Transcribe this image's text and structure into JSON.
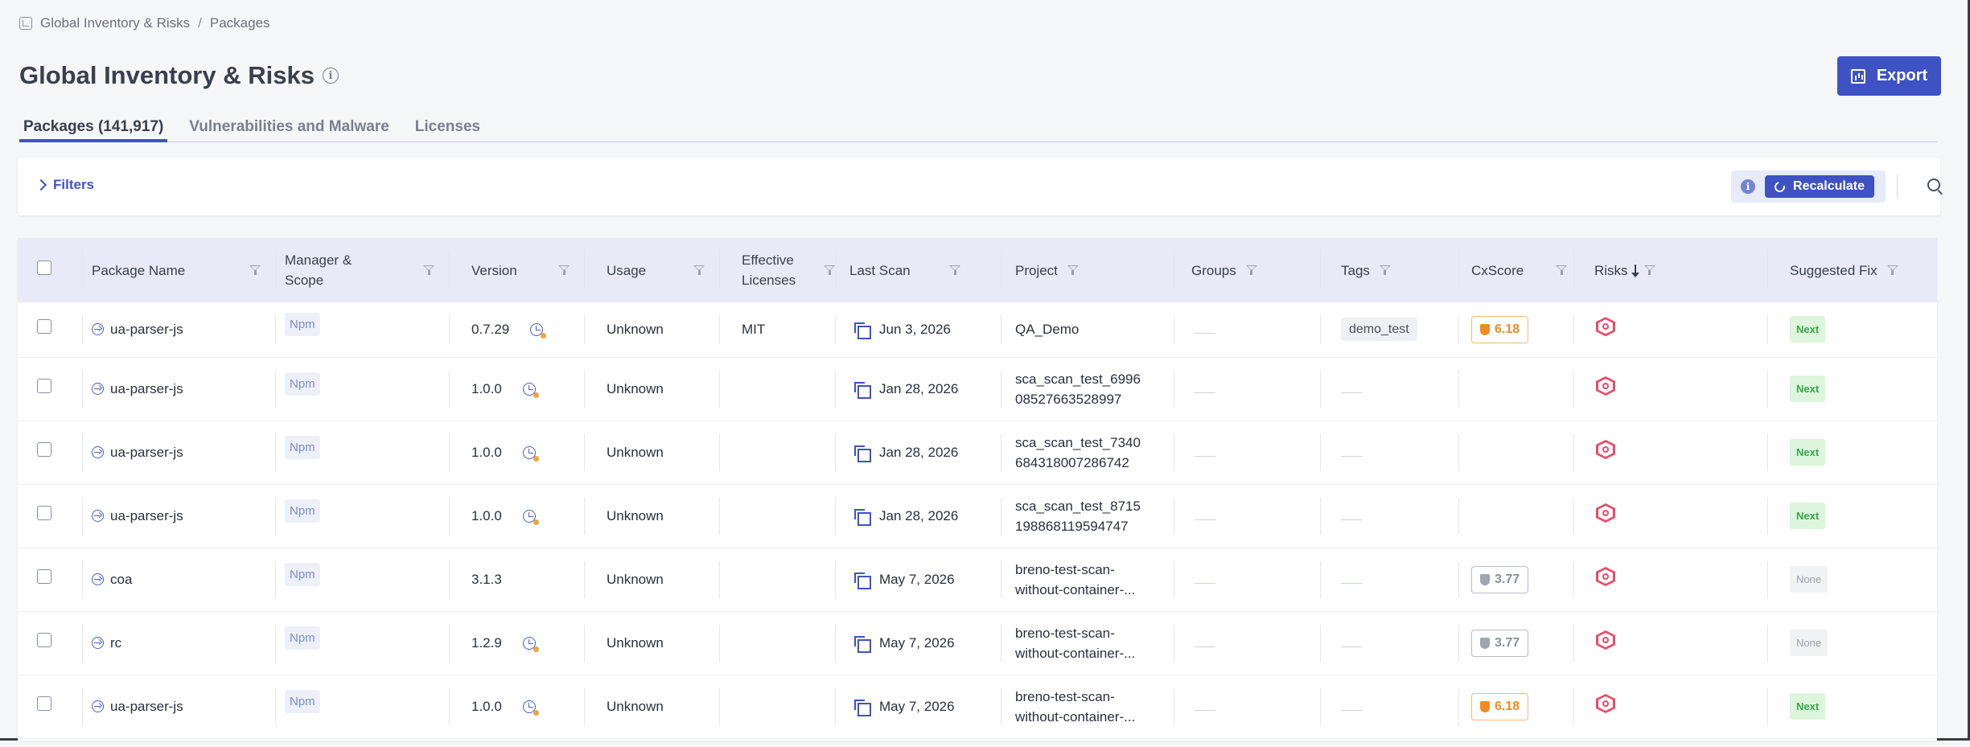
{
  "breadcrumb": {
    "root": "Global Inventory & Risks",
    "separator": "/",
    "current": "Packages"
  },
  "page": {
    "title": "Global Inventory & Risks",
    "export_label": "Export"
  },
  "tabs": [
    {
      "label": "Packages (141,917)",
      "active": true
    },
    {
      "label": "Vulnerabilities and Malware",
      "active": false
    },
    {
      "label": "Licenses",
      "active": false
    }
  ],
  "filter_bar": {
    "filters_label": "Filters",
    "recalculate_label": "Recalculate"
  },
  "columns": {
    "package_name": "Package Name",
    "manager_scope_1": "Manager &",
    "manager_scope_2": "Scope",
    "version": "Version",
    "usage": "Usage",
    "licenses_1": "Effective",
    "licenses_2": "Licenses",
    "last_scan": "Last Scan",
    "project": "Project",
    "groups": "Groups",
    "tags": "Tags",
    "cxscore": "CxScore",
    "risks": "Risks",
    "suggested_fix": "Suggested Fix"
  },
  "rows": [
    {
      "name": "ua-parser-js",
      "manager": "Npm",
      "version": "0.7.29",
      "version_flag": true,
      "usage": "Unknown",
      "license": "MIT",
      "last_scan": "Jun 3, 2026",
      "project_1": "QA_Demo",
      "project_2": "",
      "tag": "demo_test",
      "cxscore": "6.18",
      "cx_level": "warn",
      "fix": "Next"
    },
    {
      "name": "ua-parser-js",
      "manager": "Npm",
      "version": "1.0.0",
      "version_flag": true,
      "usage": "Unknown",
      "license": "",
      "last_scan": "Jan 28, 2026",
      "project_1": "sca_scan_test_6996",
      "project_2": "08527663528997",
      "tag": "",
      "cxscore": "",
      "cx_level": "",
      "fix": "Next"
    },
    {
      "name": "ua-parser-js",
      "manager": "Npm",
      "version": "1.0.0",
      "version_flag": true,
      "usage": "Unknown",
      "license": "",
      "last_scan": "Jan 28, 2026",
      "project_1": "sca_scan_test_7340",
      "project_2": "684318007286742",
      "tag": "",
      "cxscore": "",
      "cx_level": "",
      "fix": "Next"
    },
    {
      "name": "ua-parser-js",
      "manager": "Npm",
      "version": "1.0.0",
      "version_flag": true,
      "usage": "Unknown",
      "license": "",
      "last_scan": "Jan 28, 2026",
      "project_1": "sca_scan_test_8715",
      "project_2": "198868119594747",
      "tag": "",
      "cxscore": "",
      "cx_level": "",
      "fix": "Next"
    },
    {
      "name": "coa",
      "manager": "Npm",
      "version": "3.1.3",
      "version_flag": false,
      "usage": "Unknown",
      "license": "",
      "last_scan": "May 7, 2026",
      "project_1": "breno-test-scan-",
      "project_2": "without-container-...",
      "tag": "",
      "cxscore": "3.77",
      "cx_level": "neutral",
      "fix": "None"
    },
    {
      "name": "rc",
      "manager": "Npm",
      "version": "1.2.9",
      "version_flag": true,
      "usage": "Unknown",
      "license": "",
      "last_scan": "May 7, 2026",
      "project_1": "breno-test-scan-",
      "project_2": "without-container-...",
      "tag": "",
      "cxscore": "3.77",
      "cx_level": "neutral",
      "fix": "None"
    },
    {
      "name": "ua-parser-js",
      "manager": "Npm",
      "version": "1.0.0",
      "version_flag": true,
      "usage": "Unknown",
      "license": "",
      "last_scan": "May 7, 2026",
      "project_1": "breno-test-scan-",
      "project_2": "without-container-...",
      "tag": "",
      "cxscore": "6.18",
      "cx_level": "warn",
      "fix": "Next"
    }
  ],
  "colors": {
    "accent": "#3e52c4",
    "risk": "#e94b6a",
    "score_warn": "#f08a24",
    "fix_next": "#3aa54a"
  }
}
